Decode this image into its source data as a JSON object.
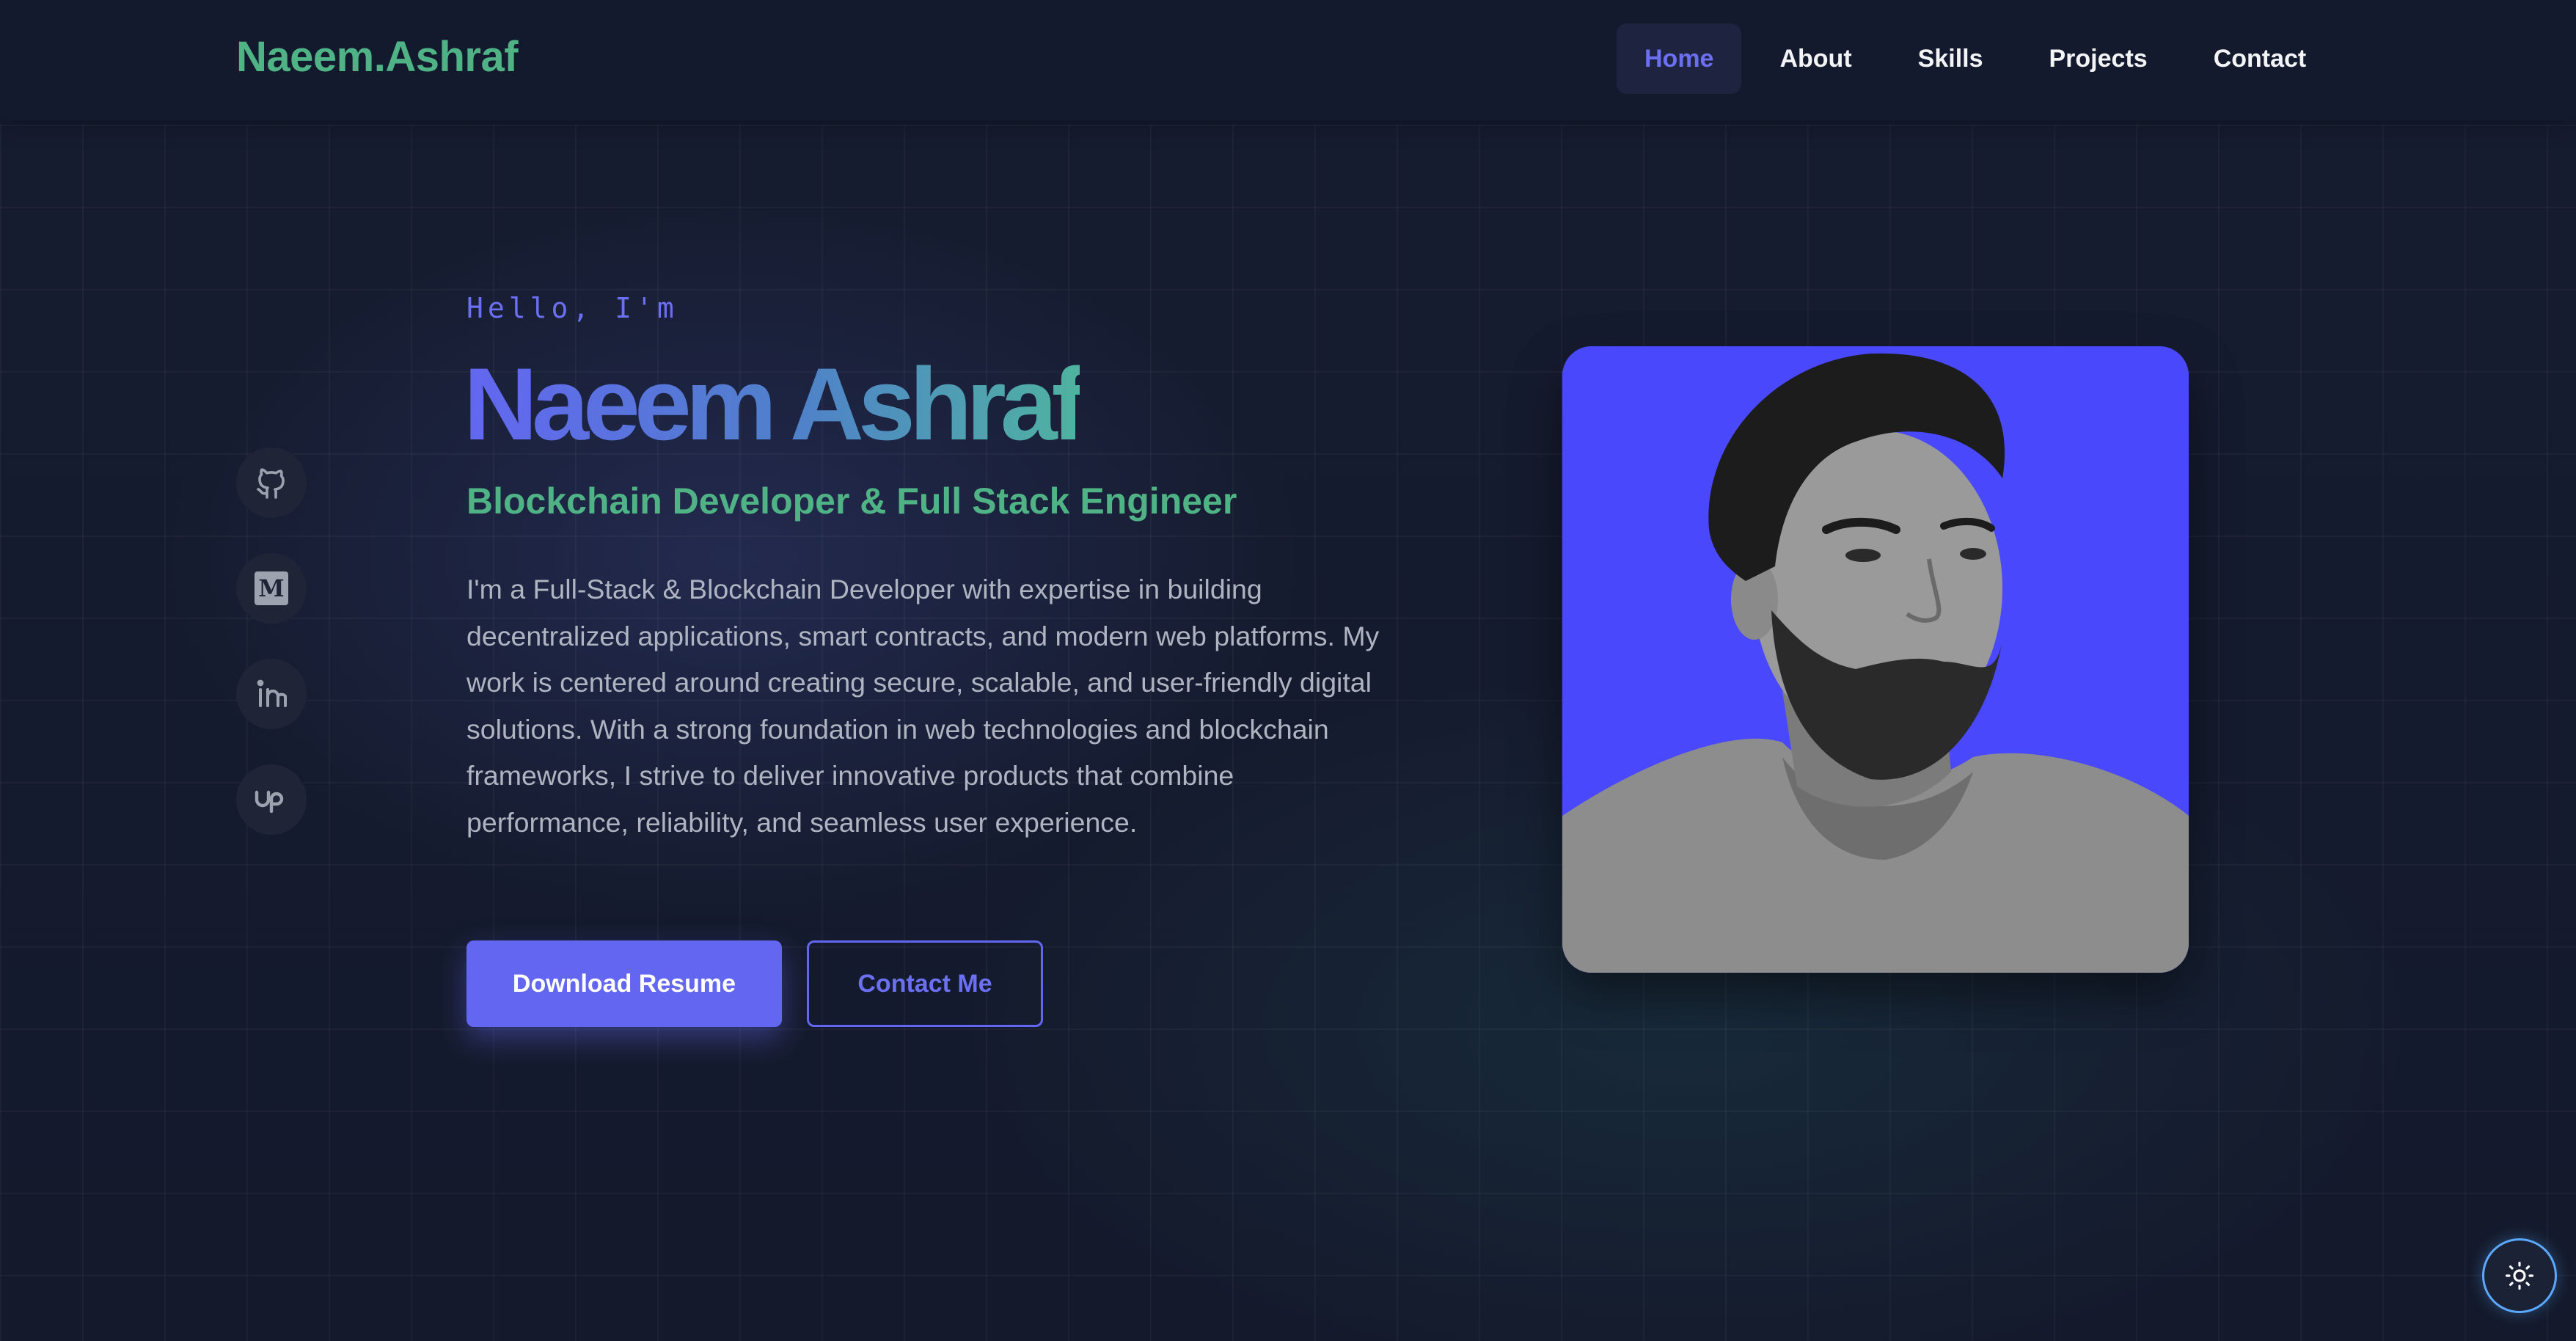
{
  "brand": {
    "logo_text": "Naeem.Ashraf",
    "accent_green": "#4fb386",
    "accent_indigo": "#6366f1"
  },
  "nav": {
    "items": [
      {
        "label": "Home",
        "active": true
      },
      {
        "label": "About",
        "active": false
      },
      {
        "label": "Skills",
        "active": false
      },
      {
        "label": "Projects",
        "active": false
      },
      {
        "label": "Contact",
        "active": false
      }
    ]
  },
  "socials": [
    {
      "icon": "github-icon"
    },
    {
      "icon": "medium-icon",
      "glyph": "M"
    },
    {
      "icon": "linkedin-icon"
    },
    {
      "icon": "upwork-icon"
    }
  ],
  "hero": {
    "greeting": "Hello, I'm",
    "name": "Naeem Ashraf",
    "role": "Blockchain Developer & Full Stack Engineer",
    "description": "I'm a Full-Stack & Blockchain Developer with expertise in building decentralized applications, smart contracts, and modern web platforms. My work is centered around creating secure, scalable, and user-friendly digital solutions. With a strong foundation in web technologies and blockchain frameworks, I strive to deliver innovative products that combine performance, reliability, and seamless user experience.",
    "primary_button": "Download Resume",
    "secondary_button": "Contact Me"
  },
  "portrait": {
    "background_color": "#4a48fd"
  },
  "theme_toggle": {
    "icon": "sun-icon"
  }
}
